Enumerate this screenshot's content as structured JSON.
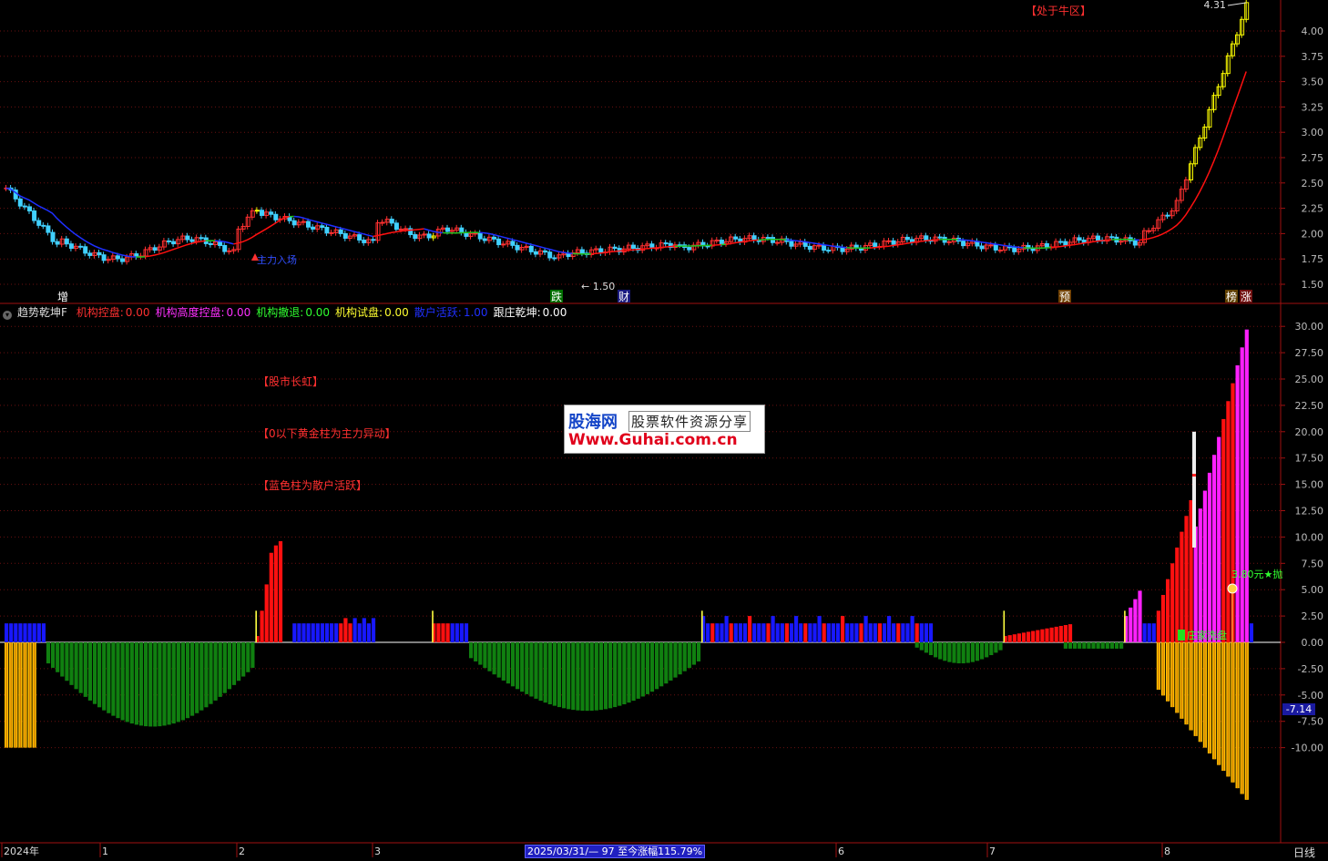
{
  "price_panel": {
    "y_ticks": [
      "4.00",
      "3.75",
      "3.50",
      "3.25",
      "3.00",
      "2.75",
      "2.50",
      "2.25",
      "2.00",
      "1.75",
      "1.50"
    ],
    "high_label": "4.31",
    "low_label": "1.50",
    "bull_zone_label": "【处于牛区】",
    "main_force_label": "主力入场",
    "event_tags": [
      {
        "text": "增",
        "color": "#ffffff",
        "bg": "#000000"
      },
      {
        "text": "跌",
        "color": "#ffffff",
        "bg": "#007000"
      },
      {
        "text": "财",
        "color": "#ffffff",
        "bg": "#1a1a80"
      },
      {
        "text": "预",
        "color": "#ffffff",
        "bg": "#704000"
      },
      {
        "text": "榜",
        "color": "#ffffff",
        "bg": "#604000"
      },
      {
        "text": "涨",
        "color": "#ffffff",
        "bg": "#701010"
      }
    ],
    "colors": {
      "up": "#ff3030",
      "down": "#40d0ff",
      "limit": "#ffff00",
      "ma_red": "#ff1010",
      "ma_blue": "#1e30ff",
      "ma_green": "#20c020"
    }
  },
  "indicator_header": {
    "name": "趋势乾坤F",
    "items": [
      {
        "label": "机构控盘:",
        "value": "0.00",
        "color": "#ff3030"
      },
      {
        "label": "机构高度控盘:",
        "value": "0.00",
        "color": "#ff30ff"
      },
      {
        "label": "机构撤退:",
        "value": "0.00",
        "color": "#30ff30"
      },
      {
        "label": "机构试盘:",
        "value": "0.00",
        "color": "#ffff30"
      },
      {
        "label": "散户活跃:",
        "value": "1.00",
        "color": "#2030ff"
      },
      {
        "label": "跟庄乾坤:",
        "value": "0.00",
        "color": "#ffffff"
      }
    ]
  },
  "indicator_panel": {
    "y_ticks": [
      "30.00",
      "27.50",
      "25.00",
      "22.50",
      "20.00",
      "17.50",
      "15.00",
      "12.50",
      "10.00",
      "7.50",
      "5.00",
      "2.50",
      "0.00",
      "-2.50",
      "-5.00",
      "-7.50",
      "-10.00"
    ],
    "current_value": "-7.14",
    "notes": [
      "【股市长虹】",
      "【0以下黄金柱为主力异动】",
      "【蓝色柱为散户活跃】"
    ],
    "price_label": "3.80元★抛",
    "dealer_label": "庄家洗盘",
    "colors": {
      "red": "#ff1010",
      "magenta": "#ff20ff",
      "blue": "#1818ff",
      "green": "#108010",
      "gold": "#ffc000"
    }
  },
  "watermark": {
    "line1": "股海网",
    "line1b": "股票软件资源分享",
    "line2": "Www.Guhai.com.cn"
  },
  "time_axis": {
    "labels": [
      "2024年",
      "1",
      "2",
      "3",
      "6",
      "7",
      "8"
    ],
    "info": "2025/03/31/— 97 至今涨幅115.79%",
    "period": "日线"
  },
  "chart_data": {
    "type": "bar",
    "title": "趋势乾坤F",
    "xlabel": "",
    "ylabel": "",
    "ylim": [
      -10,
      30
    ],
    "price_ylim": [
      1.5,
      4.31
    ]
  }
}
